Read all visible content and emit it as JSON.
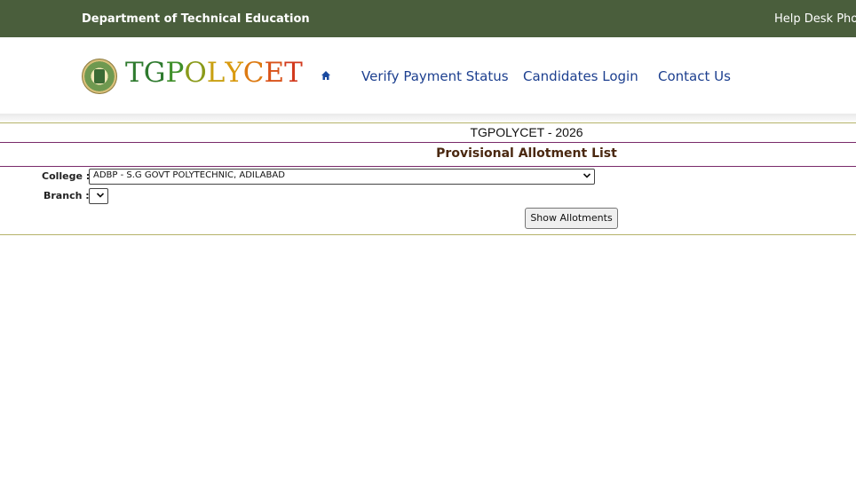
{
  "topbar": {
    "department": "Department of Technical Education",
    "help_desk": "Help Desk Pho"
  },
  "header": {
    "logo_letters": [
      "T",
      "G",
      "P",
      "O",
      "L",
      "Y",
      "C",
      "E",
      "T"
    ],
    "logo_colors": [
      "#2e7a2e",
      "#2e7a2e",
      "#3f8f2a",
      "#8a9a1a",
      "#c9a011",
      "#d99a10",
      "#dd7a12",
      "#d9531a",
      "#d23a1e"
    ],
    "nav": {
      "home_icon": "home-icon",
      "verify_payment": "Verify Payment Status",
      "candidates_login": "Candidates Login",
      "contact_us": "Contact Us"
    }
  },
  "main": {
    "exam_title": "TGPOLYCET - 2026",
    "page_title": "Provisional Allotment List",
    "college_label": "College :",
    "college_value": "ADBP - S.G GOVT POLYTECHNIC, ADILABAD",
    "branch_label": "Branch :",
    "branch_value": "",
    "show_button": "Show Allotments"
  },
  "colors": {
    "topbar_bg": "#4a5e3c",
    "nav_link": "#1c3f8f",
    "title_brown": "#4a2810",
    "rule_olive": "#b5b36a",
    "rule_purple": "#7a2a6a"
  }
}
